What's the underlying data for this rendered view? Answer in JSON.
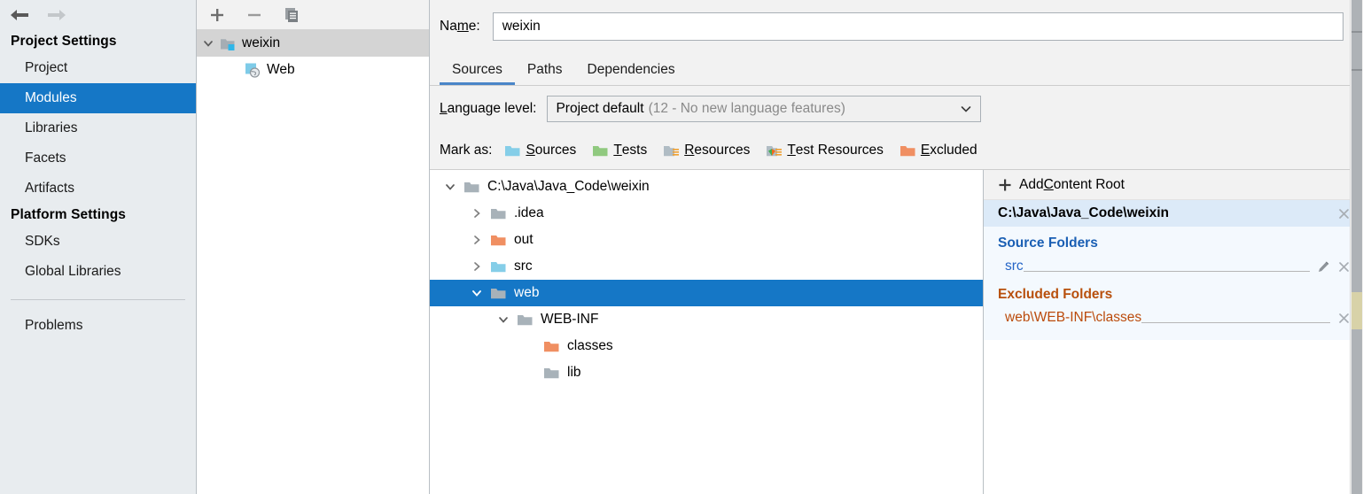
{
  "sidebar": {
    "nav": {
      "back_icon": "arrow-left-icon",
      "forward_icon": "arrow-right-icon"
    },
    "groups": [
      {
        "title": "Project Settings",
        "items": [
          {
            "label": "Project",
            "selected": false
          },
          {
            "label": "Modules",
            "selected": true
          },
          {
            "label": "Libraries",
            "selected": false
          },
          {
            "label": "Facets",
            "selected": false
          },
          {
            "label": "Artifacts",
            "selected": false
          }
        ]
      },
      {
        "title": "Platform Settings",
        "items": [
          {
            "label": "SDKs",
            "selected": false
          },
          {
            "label": "Global Libraries",
            "selected": false
          }
        ]
      }
    ],
    "problems_label": "Problems"
  },
  "modules_panel": {
    "toolbar": {
      "add_label": "+",
      "remove_label": "−",
      "copy_label": "copy"
    },
    "tree": [
      {
        "label": "weixin",
        "icon": "module-folder-icon",
        "expanded": true,
        "indent": 0,
        "selected": true
      },
      {
        "label": "Web",
        "icon": "web-facet-icon",
        "expanded": null,
        "indent": 1,
        "selected": false
      }
    ]
  },
  "main": {
    "name_label_pre": "Na",
    "name_label_mnemonic": "m",
    "name_label_post": "e:",
    "name_value": "weixin",
    "name_placeholder": "",
    "tabs": [
      {
        "label": "Sources",
        "active": true
      },
      {
        "label": "Paths",
        "active": false
      },
      {
        "label": "Dependencies",
        "active": false
      }
    ],
    "language_level": {
      "label_mnemonic": "L",
      "label_rest": "anguage level:",
      "value_main": "Project default",
      "value_sub": "(12 - No new language features)"
    },
    "mark_as": {
      "label": "Mark as:",
      "options": [
        {
          "mnemonic": "S",
          "rest": "ources",
          "icon": "folder-sources-icon",
          "color": "#85cee8"
        },
        {
          "mnemonic": "T",
          "rest": "ests",
          "icon": "folder-tests-icon",
          "color": "#90c97f"
        },
        {
          "mnemonic": "R",
          "rest": "esources",
          "icon": "folder-resources-icon",
          "color": "#b0bcc4"
        },
        {
          "mnemonic": "T",
          "rest": "est Resources",
          "icon": "folder-test-resources-icon",
          "color": "#b0bcc4"
        },
        {
          "mnemonic": "E",
          "rest": "xcluded",
          "icon": "folder-excluded-icon",
          "color": "#f08f62"
        }
      ]
    },
    "content_tree": [
      {
        "label": "C:\\Java\\Java_Code\\weixin",
        "indent": 0,
        "twisty": "down",
        "folder": "plain",
        "selected": false
      },
      {
        "label": ".idea",
        "indent": 1,
        "twisty": "right",
        "folder": "plain",
        "selected": false
      },
      {
        "label": "out",
        "indent": 1,
        "twisty": "right",
        "folder": "excluded",
        "selected": false
      },
      {
        "label": "src",
        "indent": 1,
        "twisty": "right",
        "folder": "sources",
        "selected": false
      },
      {
        "label": "web",
        "indent": 1,
        "twisty": "down",
        "folder": "plain",
        "selected": true
      },
      {
        "label": "WEB-INF",
        "indent": 2,
        "twisty": "down",
        "folder": "plain",
        "selected": false
      },
      {
        "label": "classes",
        "indent": 3,
        "twisty": "none",
        "folder": "excluded",
        "selected": false
      },
      {
        "label": "lib",
        "indent": 3,
        "twisty": "none",
        "folder": "plain",
        "selected": false
      }
    ],
    "details": {
      "add_content_root": {
        "pre": "Add ",
        "mnemonic": "C",
        "post": "ontent Root",
        "icon": "plus-icon"
      },
      "content_root_path": "C:\\Java\\Java_Code\\weixin",
      "content_root_remove_icon": "close-icon",
      "sections": [
        {
          "title": "Source Folders",
          "kind": "source",
          "color": "#1a5fb4",
          "folders": [
            {
              "name": "src",
              "has_edit": true,
              "edit_icon": "pencil-icon",
              "remove_icon": "close-icon"
            }
          ]
        },
        {
          "title": "Excluded Folders",
          "kind": "excluded",
          "color": "#b8500c",
          "folders": [
            {
              "name": "web\\WEB-INF\\classes",
              "has_edit": false,
              "edit_icon": "",
              "remove_icon": "close-icon"
            }
          ]
        }
      ]
    }
  },
  "colors": {
    "accent_selection": "#1577c6",
    "tab_underline": "#4a86c8",
    "source_blue": "#1a5fb4",
    "excluded_orange": "#b8500c",
    "sidebar_bg": "#e8ecef",
    "panel_bg": "#f2f2f2",
    "root_block_bg": "#f4f9fe",
    "root_path_bg": "#dceaf8"
  },
  "scrollbar": {
    "name": "vertical-scrollbar",
    "thumb_top_pct": 0,
    "thumb_height_pct": 40
  }
}
